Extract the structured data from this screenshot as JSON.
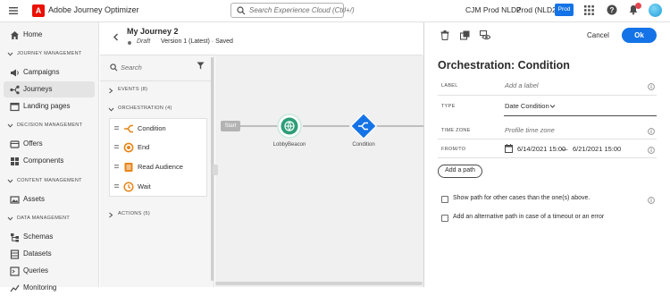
{
  "topbar": {
    "app_name": "Adobe Journey Optimizer",
    "logo_letter": "A",
    "search_placeholder": "Search Experience Cloud (Ctrl+/)",
    "org_name": "CJM Prod NLD2",
    "sandbox_name": "Prod (NLD2)",
    "env_badge": "Prod"
  },
  "leftnav": {
    "home": "Home",
    "sections": {
      "journey_management": "JOURNEY MANAGEMENT",
      "decision_management": "DECISION MANAGEMENT",
      "content_management": "CONTENT MANAGEMENT",
      "data_management": "DATA MANAGEMENT"
    },
    "items": {
      "campaigns": "Campaigns",
      "journeys": "Journeys",
      "landing_pages": "Landing pages",
      "offers": "Offers",
      "components": "Components",
      "assets": "Assets",
      "schemas": "Schemas",
      "datasets": "Datasets",
      "queries": "Queries",
      "monitoring": "Monitoring"
    }
  },
  "journey": {
    "title": "My Journey 2",
    "status": "Draft",
    "version": "Version 1 (Latest) · Saved"
  },
  "palette": {
    "search_placeholder": "Search",
    "events": "EVENTS (8)",
    "orchestration": "ORCHESTRATION (4)",
    "actions": "ACTIONS (5)",
    "activities": [
      "Condition",
      "End",
      "Read Audience",
      "Wait"
    ]
  },
  "canvas": {
    "start_label": "Start",
    "node1_label": "LobbyBeacon",
    "node2_label": "Condition"
  },
  "panel": {
    "cancel": "Cancel",
    "ok": "Ok",
    "title": "Orchestration: Condition",
    "label_field": "LABEL",
    "label_placeholder": "Add a label",
    "type_field": "TYPE",
    "type_value": "Date Condition",
    "timezone_field": "TIME ZONE",
    "timezone_placeholder": "Profile time zone",
    "fromto_field": "FROM/TO",
    "from_value": "6/14/2021 15:00",
    "to_separator": "—",
    "to_value": "6/21/2021 15:00",
    "add_path": "Add a path",
    "checkbox1": "Show path for other cases than the one(s) above.",
    "checkbox2": "Add an alternative path in case of a timeout or an error"
  },
  "colors": {
    "accent": "#1473e6",
    "adobe_red": "#eb1000",
    "node_green": "#2d9d78",
    "condition_blue": "#1473e6",
    "activity_orange": "#e68619"
  }
}
